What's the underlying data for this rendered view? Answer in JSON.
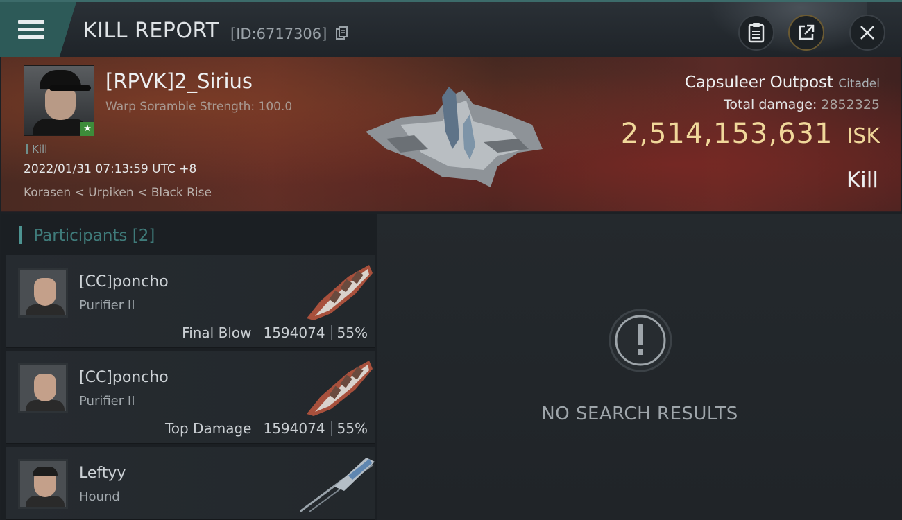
{
  "header": {
    "title": "KILL REPORT",
    "report_id": "[ID:6717306]"
  },
  "victim": {
    "name": "[RPVK]2_Sirius",
    "scramble": "Warp Soramble Strength: 100.0",
    "tag": "Kill",
    "datetime": "2022/01/31 07:13:59 UTC +8",
    "location": "Korasen < Urpiken < Black Rise"
  },
  "target": {
    "name": "Capsuleer Outpost",
    "type": "Citadel",
    "total_damage_label": "Total damage:",
    "total_damage": "2852325",
    "isk_value": "2,514,153,631",
    "isk_unit": "ISK",
    "result": "Kill"
  },
  "participants": {
    "label": "Participants",
    "count": "[2]",
    "items": [
      {
        "name": "[CC]poncho",
        "ship": "Purifier II",
        "role": "Final Blow",
        "damage": "1594074",
        "percent": "55%"
      },
      {
        "name": "[CC]poncho",
        "ship": "Purifier II",
        "role": "Top Damage",
        "damage": "1594074",
        "percent": "55%"
      },
      {
        "name": "Leftyy",
        "ship": "Hound"
      }
    ]
  },
  "empty_state": {
    "message": "NO SEARCH RESULTS"
  },
  "icons": {
    "menu": "hamburger-menu-icon",
    "copy": "copy-icon",
    "clipboard": "clipboard-icon",
    "share": "share-icon",
    "close": "close-icon",
    "alert": "exclamation-icon"
  },
  "colors": {
    "accent_teal": "#4d9391",
    "isk_gold": "#f0d79a",
    "badge_green": "#3d8c3a"
  }
}
